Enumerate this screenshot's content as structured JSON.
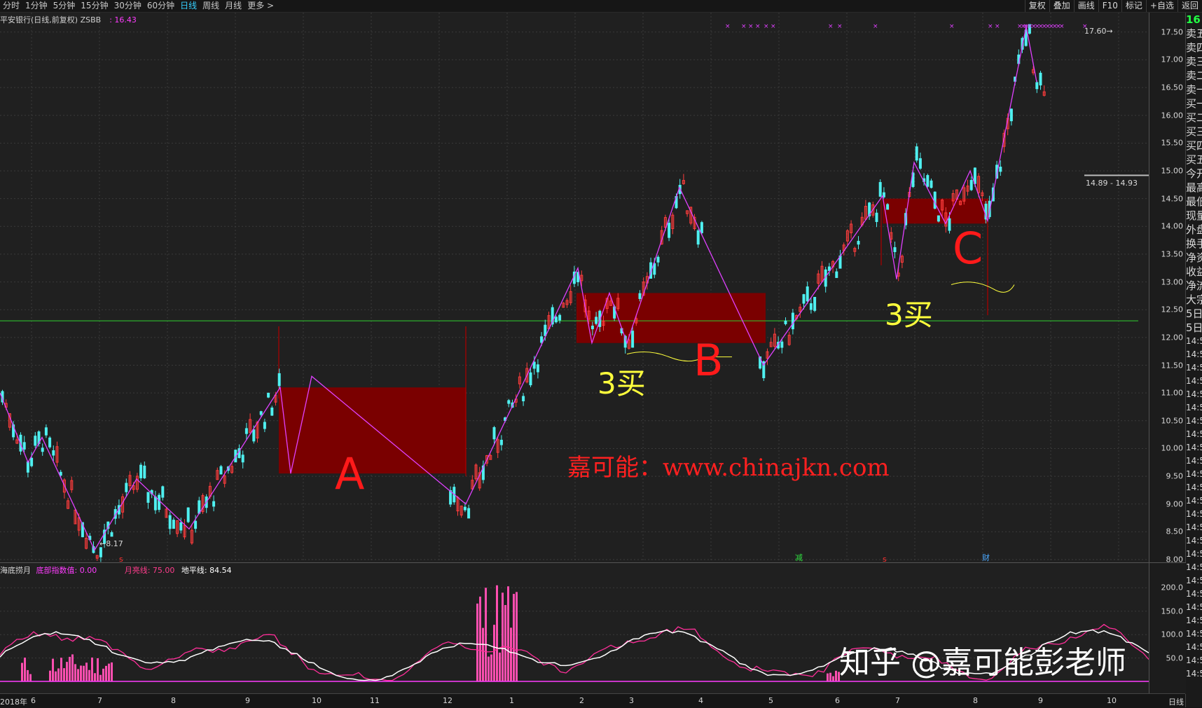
{
  "toolbar": {
    "tabs": [
      {
        "label": "分时",
        "active": false
      },
      {
        "label": "1分钟",
        "active": false
      },
      {
        "label": "5分钟",
        "active": false
      },
      {
        "label": "15分钟",
        "active": false
      },
      {
        "label": "30分钟",
        "active": false
      },
      {
        "label": "60分钟",
        "active": false
      },
      {
        "label": "日线",
        "active": true
      },
      {
        "label": "周线",
        "active": false
      },
      {
        "label": "月线",
        "active": false
      },
      {
        "label": "更多 >",
        "active": false
      }
    ],
    "right_buttons": [
      "复权",
      "叠加",
      "画线",
      "F10",
      "标记",
      "+自选",
      "返回"
    ]
  },
  "chart_title": {
    "text": "平安银行(日线,前复权) ZSBB",
    "price": ": 16.43"
  },
  "price_axis": {
    "ticks": [
      "17.50",
      "17.00",
      "16.50",
      "16.00",
      "15.50",
      "15.00",
      "14.50",
      "14.00",
      "13.50",
      "13.00",
      "12.50",
      "12.00",
      "11.50",
      "11.00",
      "10.50",
      "10.00",
      "9.50",
      "9.00",
      "8.50",
      "8.00"
    ]
  },
  "annotations": {
    "low": "8.17",
    "high": "17.60",
    "range": "14.89 - 14.93"
  },
  "zones": [
    {
      "letter": "A",
      "low": 9.55,
      "high": 11.1
    },
    {
      "letter": "B",
      "low": 11.9,
      "high": 12.8
    },
    {
      "letter": "C",
      "low": 14.05,
      "high": 14.5
    }
  ],
  "buy_labels": [
    "3买",
    "3买"
  ],
  "markers": {
    "s1": "s",
    "jian": "减",
    "s2": "s",
    "cai": "财"
  },
  "watermarks": {
    "site": "嘉可能：www.chinajkn.com",
    "platform": "知乎 @嘉可能彭老师"
  },
  "sub_legend": {
    "name": "海底捞月",
    "bottom_label": "底部指数值: 0.00",
    "moon_label": "月亮线: 75.00",
    "horizon_label": "地平线: 84.54"
  },
  "sub_axis": {
    "ticks": [
      "200.0",
      "150.0",
      "100.0",
      "50.0"
    ]
  },
  "sidebar": {
    "top": "16",
    "items": [
      "卖五",
      "卖四",
      "卖三",
      "卖二",
      "卖一",
      "买一",
      "买二",
      "买三",
      "买四",
      "买五",
      "今开",
      "最高",
      "最低",
      "现量",
      "外盘",
      "换手",
      "净资",
      "收益",
      "净流",
      "大宗",
      "5日",
      "5日"
    ],
    "times": [
      "14:5",
      "14:5",
      "14:5",
      "14:5",
      "14:5",
      "14:5",
      "14:5",
      "14:5",
      "14:5",
      "14:5",
      "14:5",
      "14:5",
      "14:5",
      "14:5",
      "14:5",
      "14:5",
      "14:5",
      "14:5",
      "14:5",
      "14:5",
      "14:5",
      "14:5",
      "14:5",
      "14:5",
      "14:5",
      "14:5"
    ]
  },
  "x_axis": {
    "ticks": [
      "2018年",
      "6",
      "7",
      "8",
      "9",
      "10",
      "11",
      "12",
      "1",
      "2",
      "3",
      "4",
      "5",
      "6",
      "7",
      "8",
      "9",
      "10"
    ],
    "period": "日线"
  },
  "chart_data": {
    "type": "candlestick",
    "title": "平安银行(日线,前复权) ZSBB",
    "ylim": [
      7.95,
      17.85
    ],
    "horizontal_line": 12.3,
    "zigzag": [
      {
        "x": 0,
        "y": 11.0
      },
      {
        "x": 40,
        "y": 9.75
      },
      {
        "x": 60,
        "y": 10.2
      },
      {
        "x": 135,
        "y": 8.17
      },
      {
        "x": 195,
        "y": 9.45
      },
      {
        "x": 270,
        "y": 8.55
      },
      {
        "x": 400,
        "y": 11.1
      },
      {
        "x": 415,
        "y": 9.55
      },
      {
        "x": 445,
        "y": 11.3
      },
      {
        "x": 665,
        "y": 9.0
      },
      {
        "x": 825,
        "y": 13.25
      },
      {
        "x": 845,
        "y": 11.9
      },
      {
        "x": 870,
        "y": 12.8
      },
      {
        "x": 895,
        "y": 11.9
      },
      {
        "x": 970,
        "y": 14.7
      },
      {
        "x": 1090,
        "y": 11.5
      },
      {
        "x": 1260,
        "y": 14.55
      },
      {
        "x": 1280,
        "y": 13.05
      },
      {
        "x": 1305,
        "y": 15.15
      },
      {
        "x": 1350,
        "y": 14.05
      },
      {
        "x": 1385,
        "y": 15.0
      },
      {
        "x": 1410,
        "y": 14.1
      },
      {
        "x": 1465,
        "y": 17.6
      },
      {
        "x": 1480,
        "y": 16.6
      }
    ],
    "series": [
      {
        "name": "底部指数值",
        "values": [
          0.0
        ]
      },
      {
        "name": "月亮线",
        "values": [
          75.0
        ]
      },
      {
        "name": "地平线",
        "values": [
          84.54
        ]
      }
    ]
  }
}
